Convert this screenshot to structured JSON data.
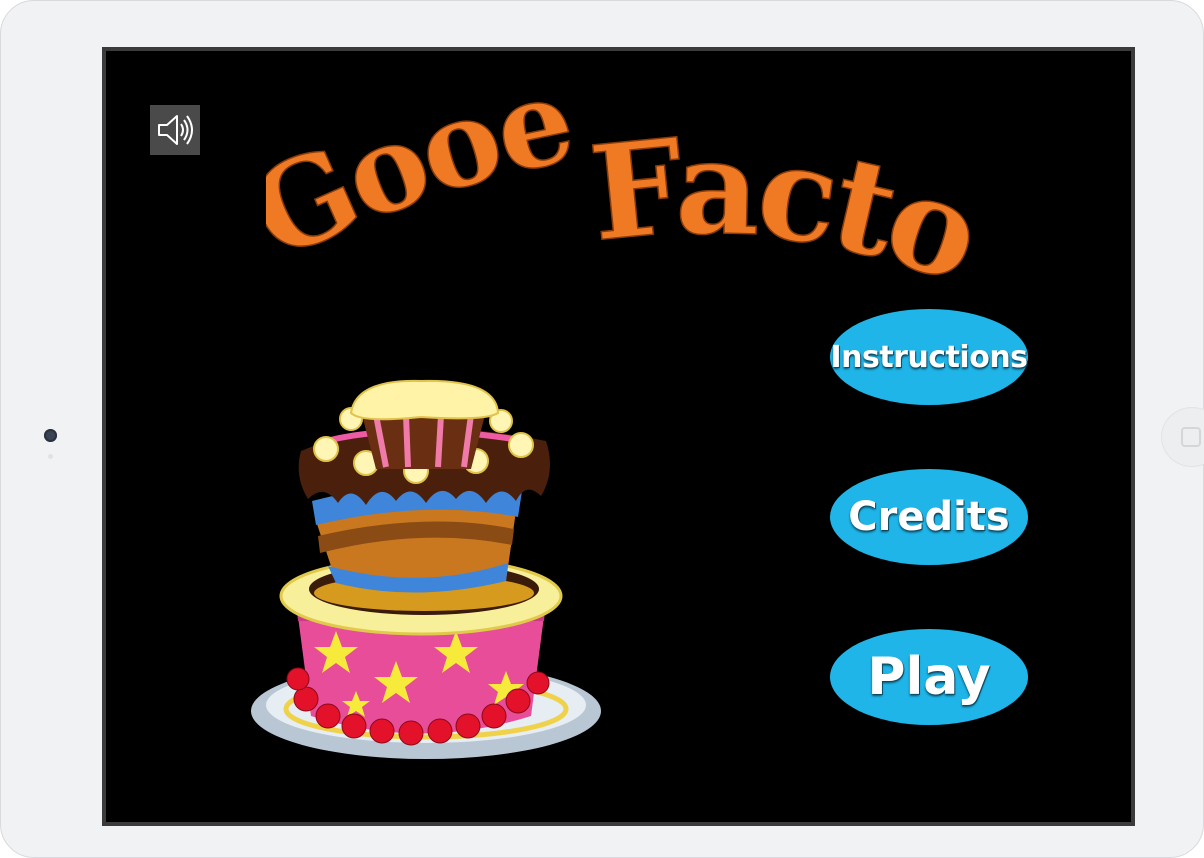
{
  "game": {
    "title_word_1": "Gooey",
    "title_word_2": "Factory",
    "title_color": "#f07a24"
  },
  "sound": {
    "icon": "speaker-icon",
    "state": "on"
  },
  "menu": {
    "instructions_label": "Instructions",
    "credits_label": "Credits",
    "play_label": "Play",
    "button_color": "#1fb5e8"
  },
  "artwork": {
    "icon": "cake-illustration"
  }
}
